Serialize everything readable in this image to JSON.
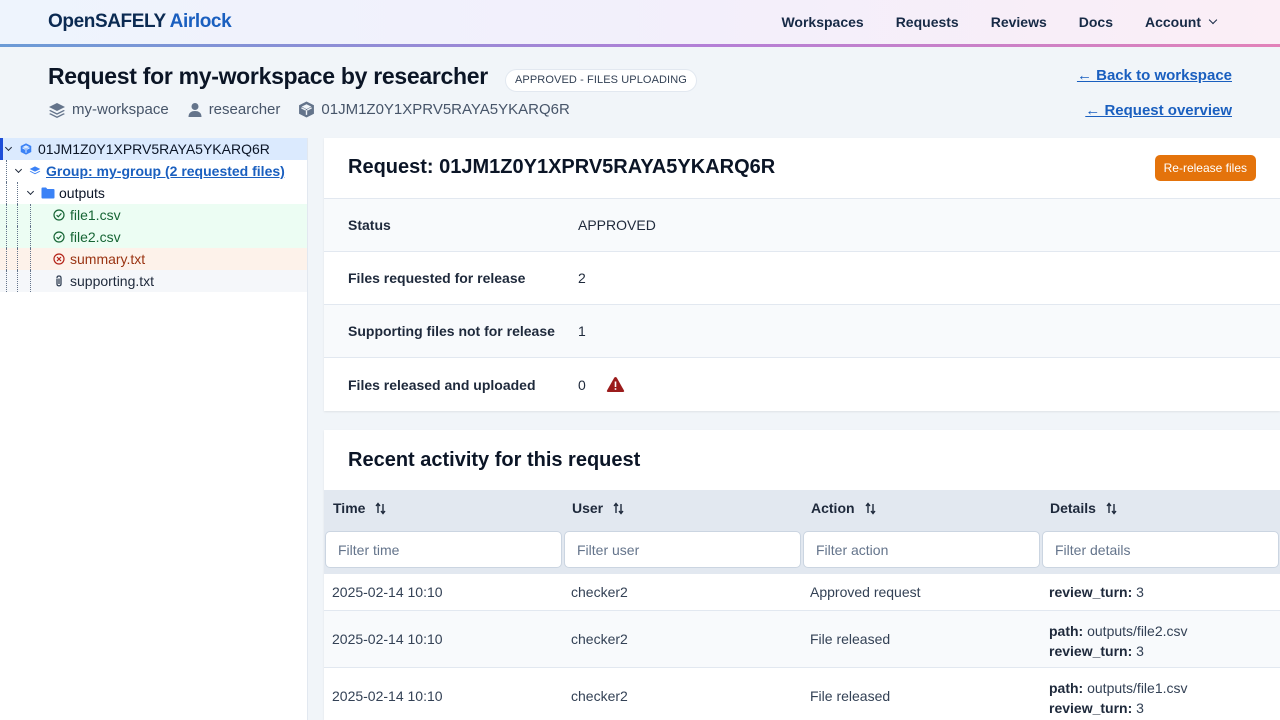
{
  "header": {
    "brand_primary": "OpenSAFELY",
    "brand_secondary": "Airlock",
    "nav": [
      "Workspaces",
      "Requests",
      "Reviews",
      "Docs",
      "Account"
    ]
  },
  "page": {
    "title": "Request for my-workspace by researcher",
    "status_badge": "APPROVED - FILES UPLOADING",
    "meta": {
      "workspace": "my-workspace",
      "user": "researcher",
      "request_id": "01JM1Z0Y1XPRV5RAYA5YKARQ6R"
    },
    "back_link": "← Back to workspace",
    "overview_link": "← Request overview"
  },
  "tree": {
    "root": "01JM1Z0Y1XPRV5RAYA5YKARQ6R",
    "group": "Group: my-group (2 requested files)",
    "folder": "outputs",
    "files": [
      {
        "name": "file1.csv",
        "state": "approved"
      },
      {
        "name": "file2.csv",
        "state": "approved"
      },
      {
        "name": "summary.txt",
        "state": "rejected"
      },
      {
        "name": "supporting.txt",
        "state": "supporting"
      }
    ]
  },
  "request": {
    "title": "Request: 01JM1Z0Y1XPRV5RAYA5YKARQ6R",
    "rerelease_label": "Re-release files",
    "rows": [
      {
        "label": "Status",
        "value": "APPROVED"
      },
      {
        "label": "Files requested for release",
        "value": "2"
      },
      {
        "label": "Supporting files not for release",
        "value": "1"
      },
      {
        "label": "Files released and uploaded",
        "value": "0"
      }
    ]
  },
  "activity": {
    "title": "Recent activity for this request",
    "columns": [
      "Time",
      "User",
      "Action",
      "Details"
    ],
    "filters": [
      "Filter time",
      "Filter user",
      "Filter action",
      "Filter details"
    ],
    "rows": [
      {
        "time": "2025-02-14 10:10",
        "user": "checker2",
        "action": "Approved request",
        "details": [
          {
            "key": "review_turn:",
            "value": "3"
          }
        ]
      },
      {
        "time": "2025-02-14 10:10",
        "user": "checker2",
        "action": "File released",
        "details": [
          {
            "key": "path:",
            "value": "outputs/file2.csv"
          },
          {
            "key": "review_turn:",
            "value": "3"
          }
        ]
      },
      {
        "time": "2025-02-14 10:10",
        "user": "checker2",
        "action": "File released",
        "details": [
          {
            "key": "path:",
            "value": "outputs/file1.csv"
          },
          {
            "key": "review_turn:",
            "value": "3"
          }
        ]
      }
    ]
  },
  "colors": {
    "brand_dark": "#0b2a52",
    "brand_blue": "#1a5fbf",
    "accent_orange": "#e4730b",
    "warning_red": "#9b1c1c",
    "approved_green": "#166534",
    "rejected_red": "#9a3412"
  }
}
